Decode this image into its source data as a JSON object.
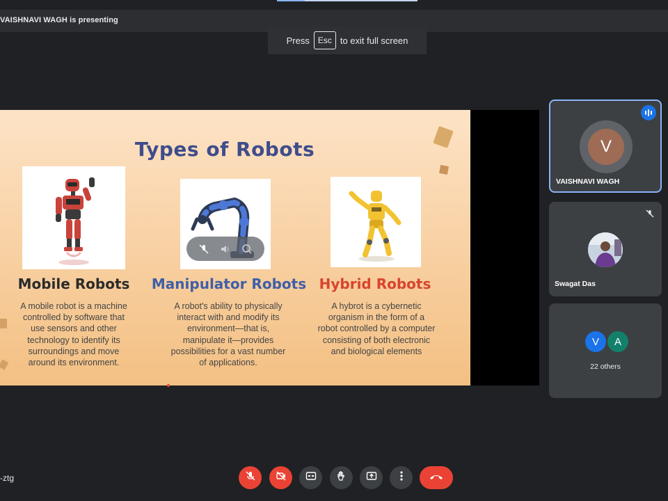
{
  "presenting": {
    "text": "VAISHNAVI WAGH is presenting"
  },
  "esc_toast": {
    "before": "Press",
    "key": "Esc",
    "after": "to exit full screen"
  },
  "slide": {
    "title": "Types of Robots",
    "robots": [
      {
        "title": "Mobile Robots",
        "desc": "A mobile robot is a machine controlled by software that use sensors and other technology to identify its surroundings and move around its environment.",
        "color": "#2b2b2b"
      },
      {
        "title": "Manipulator Robots",
        "desc": "A robot's ability to physically interact with and modify its environment—that is, manipulate it—provides possibilities for a vast number of applications.",
        "color": "#3f5fa8"
      },
      {
        "title": "Hybrid Robots",
        "desc": "A hybrot  is a cybernetic organism in the form of a robot controlled by a computer consisting of both electronic and biological elements",
        "color": "#d9442e"
      }
    ]
  },
  "participants": {
    "presenter": {
      "initial": "V",
      "name": "VAISHNAVI WAGH"
    },
    "second": {
      "name": "Swagat Das"
    },
    "others": {
      "avatars": [
        {
          "initial": "V",
          "color": "#1a73e8"
        },
        {
          "initial": "A",
          "color": "#12806a"
        }
      ],
      "label": "22 others"
    }
  },
  "meeting": {
    "code": "-ztg"
  },
  "controls": [
    {
      "name": "mic-off-button",
      "icon": "mic-off-icon"
    },
    {
      "name": "camera-off-button",
      "icon": "camera-off-icon"
    },
    {
      "name": "captions-button",
      "icon": "captions-icon"
    },
    {
      "name": "raise-hand-button",
      "icon": "hand-icon"
    },
    {
      "name": "present-button",
      "icon": "present-icon"
    },
    {
      "name": "more-options-button",
      "icon": "more-vert-icon"
    },
    {
      "name": "leave-call-button",
      "icon": "phone-hangup-icon"
    }
  ]
}
